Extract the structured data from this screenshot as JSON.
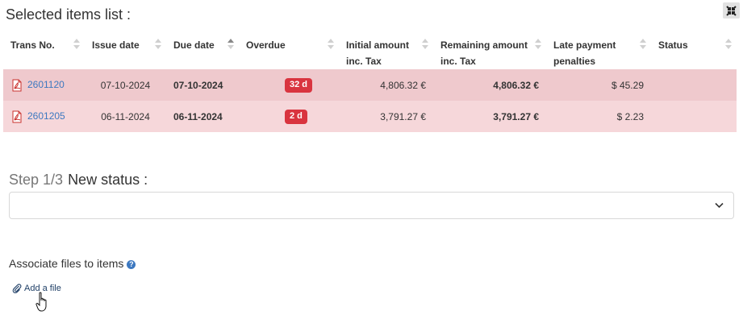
{
  "header": {
    "title": "Selected items list :",
    "expand_icon": "collapse-arrows-icon"
  },
  "table": {
    "columns": [
      {
        "label": "Trans No.",
        "sort": "none"
      },
      {
        "label": "Issue date",
        "sort": "none"
      },
      {
        "label": "Due date",
        "sort": "asc"
      },
      {
        "label": "Overdue",
        "sort": "none"
      },
      {
        "label": "Initial amount inc. Tax",
        "sort": "none"
      },
      {
        "label": "Remaining amount inc. Tax",
        "sort": "none"
      },
      {
        "label": "Late payment penalties",
        "sort": "none"
      },
      {
        "label": "Status",
        "sort": "none"
      }
    ],
    "rows": [
      {
        "trans_no": "2601120",
        "issue_date": "07-10-2024",
        "due_date": "07-10-2024",
        "overdue": "32 d",
        "initial_amount": "4,806.32 €",
        "remaining_amount": "4,806.32 €",
        "penalty": "$ 45.29",
        "status": ""
      },
      {
        "trans_no": "2601205",
        "issue_date": "06-11-2024",
        "due_date": "06-11-2024",
        "overdue": "2 d",
        "initial_amount": "3,791.27 €",
        "remaining_amount": "3,791.27 €",
        "penalty": "$ 2.23",
        "status": ""
      }
    ],
    "row_colors": [
      "#efc9cd",
      "#f6d7da"
    ],
    "badge_color": "#d9343f"
  },
  "step": {
    "step_text": "Step 1/3",
    "label": "New status :",
    "select_value": ""
  },
  "files": {
    "label": "Associate files to items",
    "help_icon": "question-icon",
    "help_text": "?",
    "add_file_label": "Add a file",
    "add_file_icon": "paperclip-icon"
  },
  "colors": {
    "link": "#3c78c0",
    "title_text": "#333333"
  }
}
